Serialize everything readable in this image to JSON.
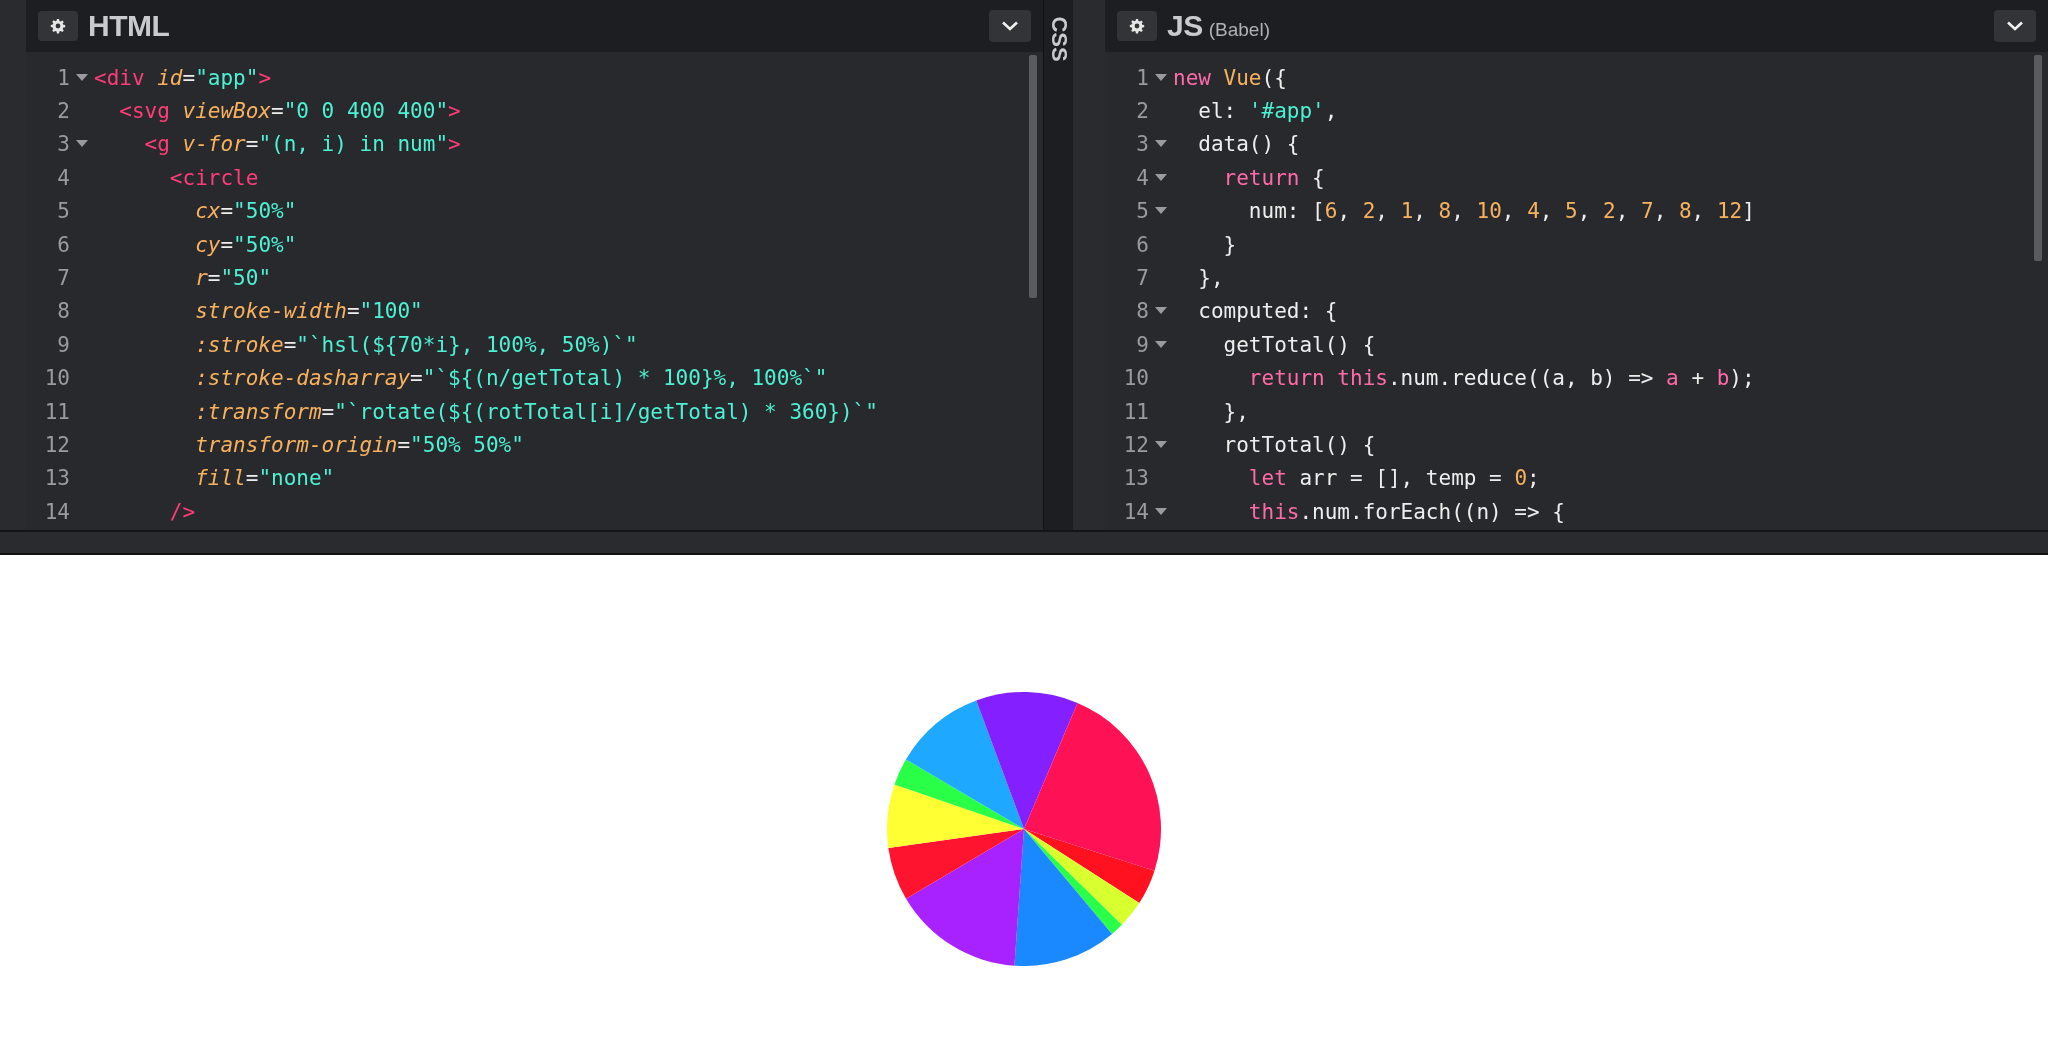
{
  "panes": [
    {
      "kind": "editor",
      "title": "HTML",
      "lines": [
        {
          "number": "1",
          "foldable": true,
          "tokens": [
            {
              "kind": "tag",
              "text": "<div"
            },
            {
              "kind": "attr",
              "text": " id"
            },
            {
              "kind": "plain",
              "text": "="
            },
            {
              "kind": "str",
              "text": "\"app\""
            },
            {
              "kind": "tag",
              "text": ">"
            }
          ]
        },
        {
          "number": "2",
          "foldable": false,
          "tokens": [
            {
              "kind": "tag",
              "text": "  <svg"
            },
            {
              "kind": "attr",
              "text": " viewBox"
            },
            {
              "kind": "plain",
              "text": "="
            },
            {
              "kind": "str",
              "text": "\"0 0 400 400\""
            },
            {
              "kind": "tag",
              "text": ">"
            }
          ]
        },
        {
          "number": "3",
          "foldable": true,
          "tokens": [
            {
              "kind": "tag",
              "text": "    <g"
            },
            {
              "kind": "attr",
              "text": " v-for"
            },
            {
              "kind": "plain",
              "text": "="
            },
            {
              "kind": "str",
              "text": "\"(n, i) in num\""
            },
            {
              "kind": "tag",
              "text": ">"
            }
          ]
        },
        {
          "number": "4",
          "foldable": false,
          "tokens": [
            {
              "kind": "tag",
              "text": "      <circle"
            }
          ]
        },
        {
          "number": "5",
          "foldable": false,
          "tokens": [
            {
              "kind": "attr",
              "text": "        cx"
            },
            {
              "kind": "plain",
              "text": "="
            },
            {
              "kind": "str",
              "text": "\"50%\""
            }
          ]
        },
        {
          "number": "6",
          "foldable": false,
          "tokens": [
            {
              "kind": "attr",
              "text": "        cy"
            },
            {
              "kind": "plain",
              "text": "="
            },
            {
              "kind": "str",
              "text": "\"50%\""
            }
          ]
        },
        {
          "number": "7",
          "foldable": false,
          "tokens": [
            {
              "kind": "attr",
              "text": "        r"
            },
            {
              "kind": "plain",
              "text": "="
            },
            {
              "kind": "str",
              "text": "\"50\""
            }
          ]
        },
        {
          "number": "8",
          "foldable": false,
          "tokens": [
            {
              "kind": "attr",
              "text": "        stroke-width"
            },
            {
              "kind": "plain",
              "text": "="
            },
            {
              "kind": "str",
              "text": "\"100\""
            }
          ]
        },
        {
          "number": "9",
          "foldable": false,
          "tokens": [
            {
              "kind": "attr",
              "text": "        :stroke"
            },
            {
              "kind": "plain",
              "text": "="
            },
            {
              "kind": "str",
              "text": "\"`hsl(${70*i}, 100%, 50%)`\""
            }
          ]
        },
        {
          "number": "10",
          "foldable": false,
          "tokens": [
            {
              "kind": "attr",
              "text": "        :stroke-dasharray"
            },
            {
              "kind": "plain",
              "text": "="
            },
            {
              "kind": "str",
              "text": "\"`${(n/getTotal) * 100}%, 100%`\""
            }
          ]
        },
        {
          "number": "11",
          "foldable": false,
          "tokens": [
            {
              "kind": "attr",
              "text": "        :transform"
            },
            {
              "kind": "plain",
              "text": "="
            },
            {
              "kind": "str",
              "text": "\"`rotate(${(rotTotal[i]/getTotal) * 360})`\""
            }
          ]
        },
        {
          "number": "12",
          "foldable": false,
          "tokens": [
            {
              "kind": "attr",
              "text": "        transform-origin"
            },
            {
              "kind": "plain",
              "text": "="
            },
            {
              "kind": "str",
              "text": "\"50% 50%\""
            }
          ]
        },
        {
          "number": "13",
          "foldable": false,
          "tokens": [
            {
              "kind": "attr",
              "text": "        fill"
            },
            {
              "kind": "plain",
              "text": "="
            },
            {
              "kind": "str",
              "text": "\"none\""
            }
          ]
        },
        {
          "number": "14",
          "foldable": false,
          "tokens": [
            {
              "kind": "tag",
              "text": "      />"
            }
          ]
        }
      ]
    },
    {
      "kind": "collapsed",
      "title": "CSS"
    },
    {
      "kind": "editor",
      "title": "JS",
      "subtitle": "(Babel)",
      "lines": [
        {
          "number": "1",
          "foldable": true,
          "tokens": [
            {
              "kind": "kw",
              "text": "new"
            },
            {
              "kind": "cls",
              "text": " Vue"
            },
            {
              "kind": "plain",
              "text": "({"
            }
          ]
        },
        {
          "number": "2",
          "foldable": false,
          "tokens": [
            {
              "kind": "plain",
              "text": "  el: "
            },
            {
              "kind": "str",
              "text": "'#app'"
            },
            {
              "kind": "plain",
              "text": ","
            }
          ]
        },
        {
          "number": "3",
          "foldable": true,
          "tokens": [
            {
              "kind": "plain",
              "text": "  data() {"
            }
          ]
        },
        {
          "number": "4",
          "foldable": true,
          "tokens": [
            {
              "kind": "kw",
              "text": "    return"
            },
            {
              "kind": "plain",
              "text": " {"
            }
          ]
        },
        {
          "number": "5",
          "foldable": true,
          "tokens": [
            {
              "kind": "plain",
              "text": "      num: ["
            },
            {
              "kind": "num",
              "text": "6"
            },
            {
              "kind": "plain",
              "text": ", "
            },
            {
              "kind": "num",
              "text": "2"
            },
            {
              "kind": "plain",
              "text": ", "
            },
            {
              "kind": "num",
              "text": "1"
            },
            {
              "kind": "plain",
              "text": ", "
            },
            {
              "kind": "num",
              "text": "8"
            },
            {
              "kind": "plain",
              "text": ", "
            },
            {
              "kind": "num",
              "text": "10"
            },
            {
              "kind": "plain",
              "text": ", "
            },
            {
              "kind": "num",
              "text": "4"
            },
            {
              "kind": "plain",
              "text": ", "
            },
            {
              "kind": "num",
              "text": "5"
            },
            {
              "kind": "plain",
              "text": ", "
            },
            {
              "kind": "num",
              "text": "2"
            },
            {
              "kind": "plain",
              "text": ", "
            },
            {
              "kind": "num",
              "text": "7"
            },
            {
              "kind": "plain",
              "text": ", "
            },
            {
              "kind": "num",
              "text": "8"
            },
            {
              "kind": "plain",
              "text": ", "
            },
            {
              "kind": "num",
              "text": "12"
            },
            {
              "kind": "plain",
              "text": "]"
            }
          ]
        },
        {
          "number": "6",
          "foldable": false,
          "tokens": [
            {
              "kind": "plain",
              "text": "    }"
            }
          ]
        },
        {
          "number": "7",
          "foldable": false,
          "tokens": [
            {
              "kind": "plain",
              "text": "  },"
            }
          ]
        },
        {
          "number": "8",
          "foldable": true,
          "tokens": [
            {
              "kind": "plain",
              "text": "  computed: {"
            }
          ]
        },
        {
          "number": "9",
          "foldable": true,
          "tokens": [
            {
              "kind": "plain",
              "text": "    getTotal() {"
            }
          ]
        },
        {
          "number": "10",
          "foldable": false,
          "tokens": [
            {
              "kind": "kw",
              "text": "      return"
            },
            {
              "kind": "kw",
              "text": " this"
            },
            {
              "kind": "plain",
              "text": ".num.reduce((a, b) => "
            },
            {
              "kind": "kw",
              "text": "a"
            },
            {
              "kind": "plain",
              "text": " + "
            },
            {
              "kind": "kw",
              "text": "b"
            },
            {
              "kind": "plain",
              "text": ");"
            }
          ]
        },
        {
          "number": "11",
          "foldable": false,
          "tokens": [
            {
              "kind": "plain",
              "text": "    },"
            }
          ]
        },
        {
          "number": "12",
          "foldable": true,
          "tokens": [
            {
              "kind": "plain",
              "text": "    rotTotal() {"
            }
          ]
        },
        {
          "number": "13",
          "foldable": false,
          "tokens": [
            {
              "kind": "kw",
              "text": "      let"
            },
            {
              "kind": "plain",
              "text": " arr = [], temp = "
            },
            {
              "kind": "num",
              "text": "0"
            },
            {
              "kind": "plain",
              "text": ";"
            }
          ]
        },
        {
          "number": "14",
          "foldable": true,
          "tokens": [
            {
              "kind": "kw",
              "text": "      this"
            },
            {
              "kind": "plain",
              "text": ".num.forEach((n) => {"
            }
          ]
        }
      ]
    }
  ]
}
